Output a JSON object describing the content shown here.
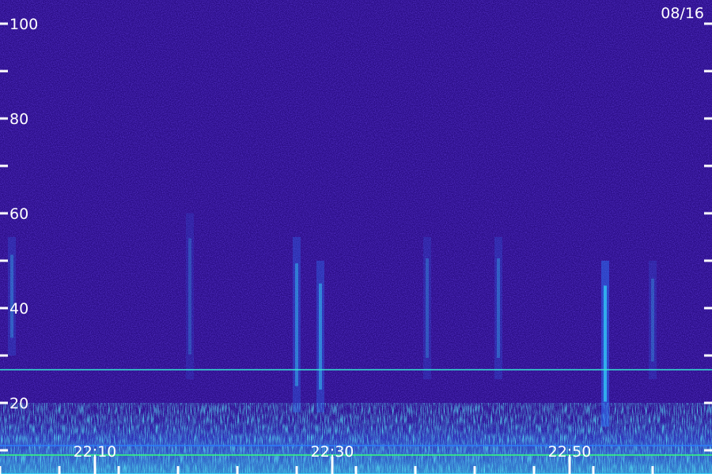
{
  "chart_data": {
    "type": "heatmap",
    "title": "",
    "xlabel": "",
    "ylabel": "",
    "date_label": "08/16",
    "ylim": [
      0,
      100
    ],
    "y_tick_labels": [
      {
        "value": 100,
        "label": "100"
      },
      {
        "value": 80,
        "label": "80"
      },
      {
        "value": 60,
        "label": "60"
      },
      {
        "value": 40,
        "label": "40"
      },
      {
        "value": 20,
        "label": "20"
      }
    ],
    "y_minor_ticks": [
      10,
      30,
      50,
      70,
      90
    ],
    "x_range": [
      "22:02",
      "22:62"
    ],
    "x_tick_labels": [
      {
        "time": "22:10",
        "label": "22:10"
      },
      {
        "time": "22:30",
        "label": "22:30"
      },
      {
        "time": "22:50",
        "label": "22:50"
      }
    ],
    "x_minor_ticks": [
      "22:02",
      "22:07",
      "22:12",
      "22:17",
      "22:22",
      "22:27",
      "22:32",
      "22:37",
      "22:42",
      "22:47",
      "22:52",
      "22:57"
    ],
    "background_color": "#2a0d86",
    "colormap": [
      "#12005a",
      "#2a0d86",
      "#3d2fd8",
      "#2b7cff",
      "#32e6ff",
      "#35ff7a"
    ],
    "horizontal_lines": [
      {
        "level": 27,
        "color": "#35e6d0"
      },
      {
        "level": 11,
        "color": "#2b7cff"
      },
      {
        "level": 9,
        "color": "#35ff7a"
      },
      {
        "level": 5,
        "color": "#32e6ff"
      }
    ],
    "vertical_bursts": [
      {
        "time": "22:03",
        "from": 30,
        "to": 55,
        "intensity": 0.35
      },
      {
        "time": "22:18",
        "from": 25,
        "to": 60,
        "intensity": 0.25
      },
      {
        "time": "22:27",
        "from": 18,
        "to": 55,
        "intensity": 0.5
      },
      {
        "time": "22:29",
        "from": 18,
        "to": 50,
        "intensity": 0.55
      },
      {
        "time": "22:38",
        "from": 25,
        "to": 55,
        "intensity": 0.3
      },
      {
        "time": "22:44",
        "from": 25,
        "to": 55,
        "intensity": 0.35
      },
      {
        "time": "22:53",
        "from": 15,
        "to": 50,
        "intensity": 0.8
      },
      {
        "time": "22:57",
        "from": 25,
        "to": 50,
        "intensity": 0.3
      }
    ]
  }
}
